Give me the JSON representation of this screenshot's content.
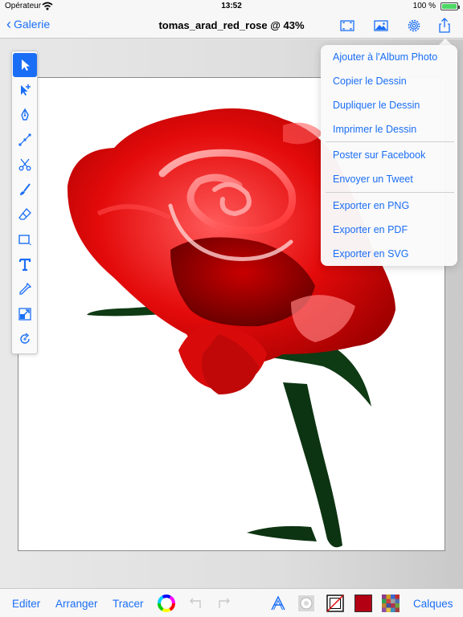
{
  "status_bar": {
    "carrier": "Opérateur",
    "time": "13:52",
    "battery": "100 %"
  },
  "navbar": {
    "back_label": "Galerie",
    "title": "tomas_arad_red_rose @ 43%",
    "icons": [
      "fullscreen-icon",
      "image-icon",
      "gear-icon",
      "share-icon"
    ]
  },
  "share_menu": {
    "items": [
      "Ajouter à l'Album Photo",
      "Copier le Dessin",
      "Dupliquer le Dessin",
      "Imprimer le Dessin",
      "Poster sur Facebook",
      "Envoyer un Tweet",
      "Exporter en PNG",
      "Exporter en PDF",
      "Exporter en SVG"
    ]
  },
  "tools": [
    "select-arrow-icon",
    "direct-select-icon",
    "pen-icon",
    "node-edit-icon",
    "scissors-icon",
    "brush-icon",
    "eraser-icon",
    "rectangle-icon",
    "text-icon",
    "eyedropper-icon",
    "transform-icon",
    "rotate-icon"
  ],
  "bottom_toolbar": {
    "edit_label": "Editer",
    "arrange_label": "Arranger",
    "trace_label": "Tracer",
    "layers_label": "Calques",
    "fill_color": "#b30012"
  },
  "colors": {
    "accent": "#1a6ef5",
    "rose_red": "#e01010",
    "stem_green": "#0e3a14"
  }
}
